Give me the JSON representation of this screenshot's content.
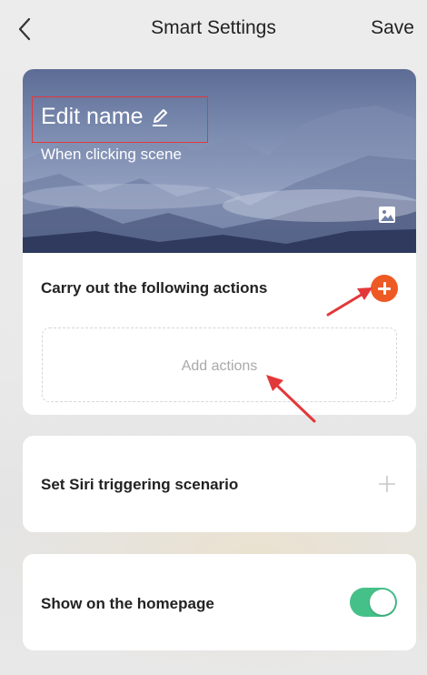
{
  "header": {
    "title": "Smart Settings",
    "save_label": "Save",
    "back_icon": "chevron-left-icon"
  },
  "scene": {
    "name": "Edit name",
    "subtitle": "When clicking  scene",
    "edit_icon": "pencil-icon",
    "change_image_icon": "image-icon"
  },
  "actions": {
    "title": "Carry out the following actions",
    "add_placeholder": "Add actions",
    "add_icon": "plus-circle-icon",
    "accent_color": "#ee5a24"
  },
  "siri": {
    "label": "Set Siri triggering scenario",
    "icon": "plus-icon"
  },
  "homepage": {
    "label": "Show on the homepage",
    "toggle_on": true,
    "toggle_color": "#46c089"
  },
  "annotations": {
    "arrow_color": "#e3383a",
    "highlight_color": "#e3383a"
  }
}
